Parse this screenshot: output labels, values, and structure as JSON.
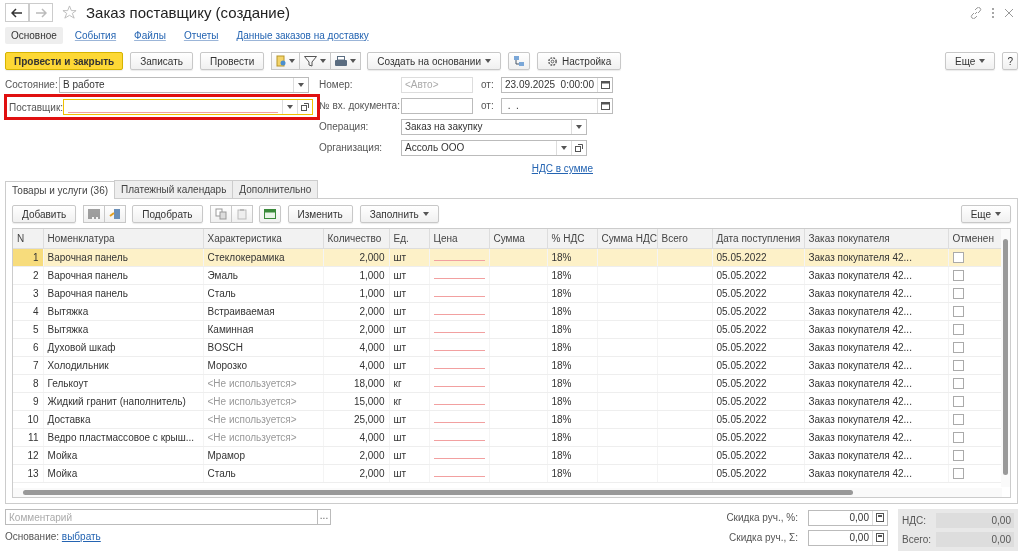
{
  "window": {
    "title": "Заказ поставщику (создание)"
  },
  "nav": [
    {
      "label": "Основное",
      "selected": true
    },
    {
      "label": "События",
      "selected": false
    },
    {
      "label": "Файлы",
      "selected": false
    },
    {
      "label": "Отчеты",
      "selected": false
    },
    {
      "label": "Данные заказов на доставку",
      "selected": false
    }
  ],
  "toolbar": [
    {
      "kind": "primary",
      "label": "Провести и закрыть"
    },
    {
      "kind": "plain",
      "label": "Записать"
    },
    {
      "kind": "plain",
      "label": "Провести"
    },
    {
      "kind": "icon-group"
    },
    {
      "kind": "dropdown",
      "label": "Создать на основании"
    },
    {
      "kind": "icon"
    },
    {
      "kind": "settings",
      "label": "Настройка"
    }
  ],
  "toolbar_right": {
    "more": "Еще",
    "help": "?"
  },
  "state": {
    "label": "Состояние:",
    "value": "В работе"
  },
  "supplier": {
    "label": "Поставщик:",
    "highlighted": true
  },
  "number": {
    "label": "Номер:",
    "placeholder": "<Авто>",
    "date_label": "от:",
    "date": "23.09.2025  0:00:00"
  },
  "incoming": {
    "label": "№ вх. документа:",
    "date_label": "от:",
    "date": " .  ."
  },
  "operation": {
    "label": "Операция:",
    "value": "Заказ на закупку"
  },
  "organization": {
    "label": "Организация:",
    "value": "Ассоль ООО"
  },
  "vat_link": "НДС в сумме",
  "tabs": [
    {
      "label": "Товары и услуги (36)",
      "selected": true
    },
    {
      "label": "Платежный календарь",
      "selected": false
    },
    {
      "label": "Дополнительно",
      "selected": false
    }
  ],
  "table_toolbar": [
    {
      "kind": "plain",
      "label": "Добавить"
    },
    {
      "kind": "scan-icons"
    },
    {
      "kind": "plain",
      "label": "Подобрать"
    },
    {
      "kind": "copy-icons"
    },
    {
      "kind": "excel-icon"
    },
    {
      "kind": "plain",
      "label": "Изменить"
    },
    {
      "kind": "dropdown",
      "label": "Заполнить"
    }
  ],
  "table_more": "Еще",
  "table": {
    "columns": [
      "N",
      "Номенклатура",
      "Характеристика",
      "Количество",
      "Ед.",
      "Цена",
      "Сумма",
      "% НДС",
      "Сумма НДС",
      "Всего",
      "Дата поступления",
      "Заказ покупателя",
      "Отменен"
    ],
    "rows": [
      {
        "n": "1",
        "item": "Варочная панель",
        "feature": "Стеклокерамика",
        "feature_unused": false,
        "qty": "2,000",
        "unit": "шт",
        "vat": "18%",
        "date": "05.05.2022",
        "order": "Заказ покупателя 42...",
        "cancelled": false,
        "selected": true
      },
      {
        "n": "2",
        "item": "Варочная панель",
        "feature": "Эмаль",
        "feature_unused": false,
        "qty": "1,000",
        "unit": "шт",
        "vat": "18%",
        "date": "05.05.2022",
        "order": "Заказ покупателя 42...",
        "cancelled": false,
        "selected": false
      },
      {
        "n": "3",
        "item": "Варочная панель",
        "feature": "Сталь",
        "feature_unused": false,
        "qty": "1,000",
        "unit": "шт",
        "vat": "18%",
        "date": "05.05.2022",
        "order": "Заказ покупателя 42...",
        "cancelled": false,
        "selected": false
      },
      {
        "n": "4",
        "item": "Вытяжка",
        "feature": "Встраиваемая",
        "feature_unused": false,
        "qty": "2,000",
        "unit": "шт",
        "vat": "18%",
        "date": "05.05.2022",
        "order": "Заказ покупателя 42...",
        "cancelled": false,
        "selected": false
      },
      {
        "n": "5",
        "item": "Вытяжка",
        "feature": "Каминная",
        "feature_unused": false,
        "qty": "2,000",
        "unit": "шт",
        "vat": "18%",
        "date": "05.05.2022",
        "order": "Заказ покупателя 42...",
        "cancelled": false,
        "selected": false
      },
      {
        "n": "6",
        "item": "Духовой шкаф",
        "feature": "BOSCH",
        "feature_unused": false,
        "qty": "4,000",
        "unit": "шт",
        "vat": "18%",
        "date": "05.05.2022",
        "order": "Заказ покупателя 42...",
        "cancelled": false,
        "selected": false
      },
      {
        "n": "7",
        "item": "Холодильник",
        "feature": "Морозко",
        "feature_unused": false,
        "qty": "4,000",
        "unit": "шт",
        "vat": "18%",
        "date": "05.05.2022",
        "order": "Заказ покупателя 42...",
        "cancelled": false,
        "selected": false
      },
      {
        "n": "8",
        "item": "Гелькоут",
        "feature": "<Не используется>",
        "feature_unused": true,
        "qty": "18,000",
        "unit": "кг",
        "vat": "18%",
        "date": "05.05.2022",
        "order": "Заказ покупателя 42...",
        "cancelled": false,
        "selected": false
      },
      {
        "n": "9",
        "item": "Жидкий гранит (наполнитель)",
        "feature": "<Не используется>",
        "feature_unused": true,
        "qty": "15,000",
        "unit": "кг",
        "vat": "18%",
        "date": "05.05.2022",
        "order": "Заказ покупателя 42...",
        "cancelled": false,
        "selected": false
      },
      {
        "n": "10",
        "item": "Доставка",
        "feature": "<Не используется>",
        "feature_unused": true,
        "qty": "25,000",
        "unit": "шт",
        "vat": "18%",
        "date": "05.05.2022",
        "order": "Заказ покупателя 42...",
        "cancelled": false,
        "selected": false
      },
      {
        "n": "11",
        "item": "Ведро пластмассовое с крыш...",
        "feature": "<Не используется>",
        "feature_unused": true,
        "qty": "4,000",
        "unit": "шт",
        "vat": "18%",
        "date": "05.05.2022",
        "order": "Заказ покупателя 42...",
        "cancelled": false,
        "selected": false
      },
      {
        "n": "12",
        "item": "Мойка",
        "feature": "Мрамор",
        "feature_unused": false,
        "qty": "2,000",
        "unit": "шт",
        "vat": "18%",
        "date": "05.05.2022",
        "order": "Заказ покупателя 42...",
        "cancelled": false,
        "selected": false
      },
      {
        "n": "13",
        "item": "Мойка",
        "feature": "Сталь",
        "feature_unused": false,
        "qty": "2,000",
        "unit": "шт",
        "vat": "18%",
        "date": "05.05.2022",
        "order": "Заказ покупателя 42...",
        "cancelled": false,
        "selected": false
      }
    ]
  },
  "comment": {
    "placeholder": "Комментарий",
    "button": "..."
  },
  "basis": {
    "label": "Основание:",
    "link": "выбрать"
  },
  "discount_percent": {
    "label": "Скидка руч., %:",
    "value": "0,00"
  },
  "discount_sum": {
    "label": "Скидка руч., Σ:",
    "value": "0,00"
  },
  "totals": [
    {
      "label": "НДС:",
      "value": "0,00"
    },
    {
      "label": "Всего:",
      "value": "0,00"
    }
  ]
}
